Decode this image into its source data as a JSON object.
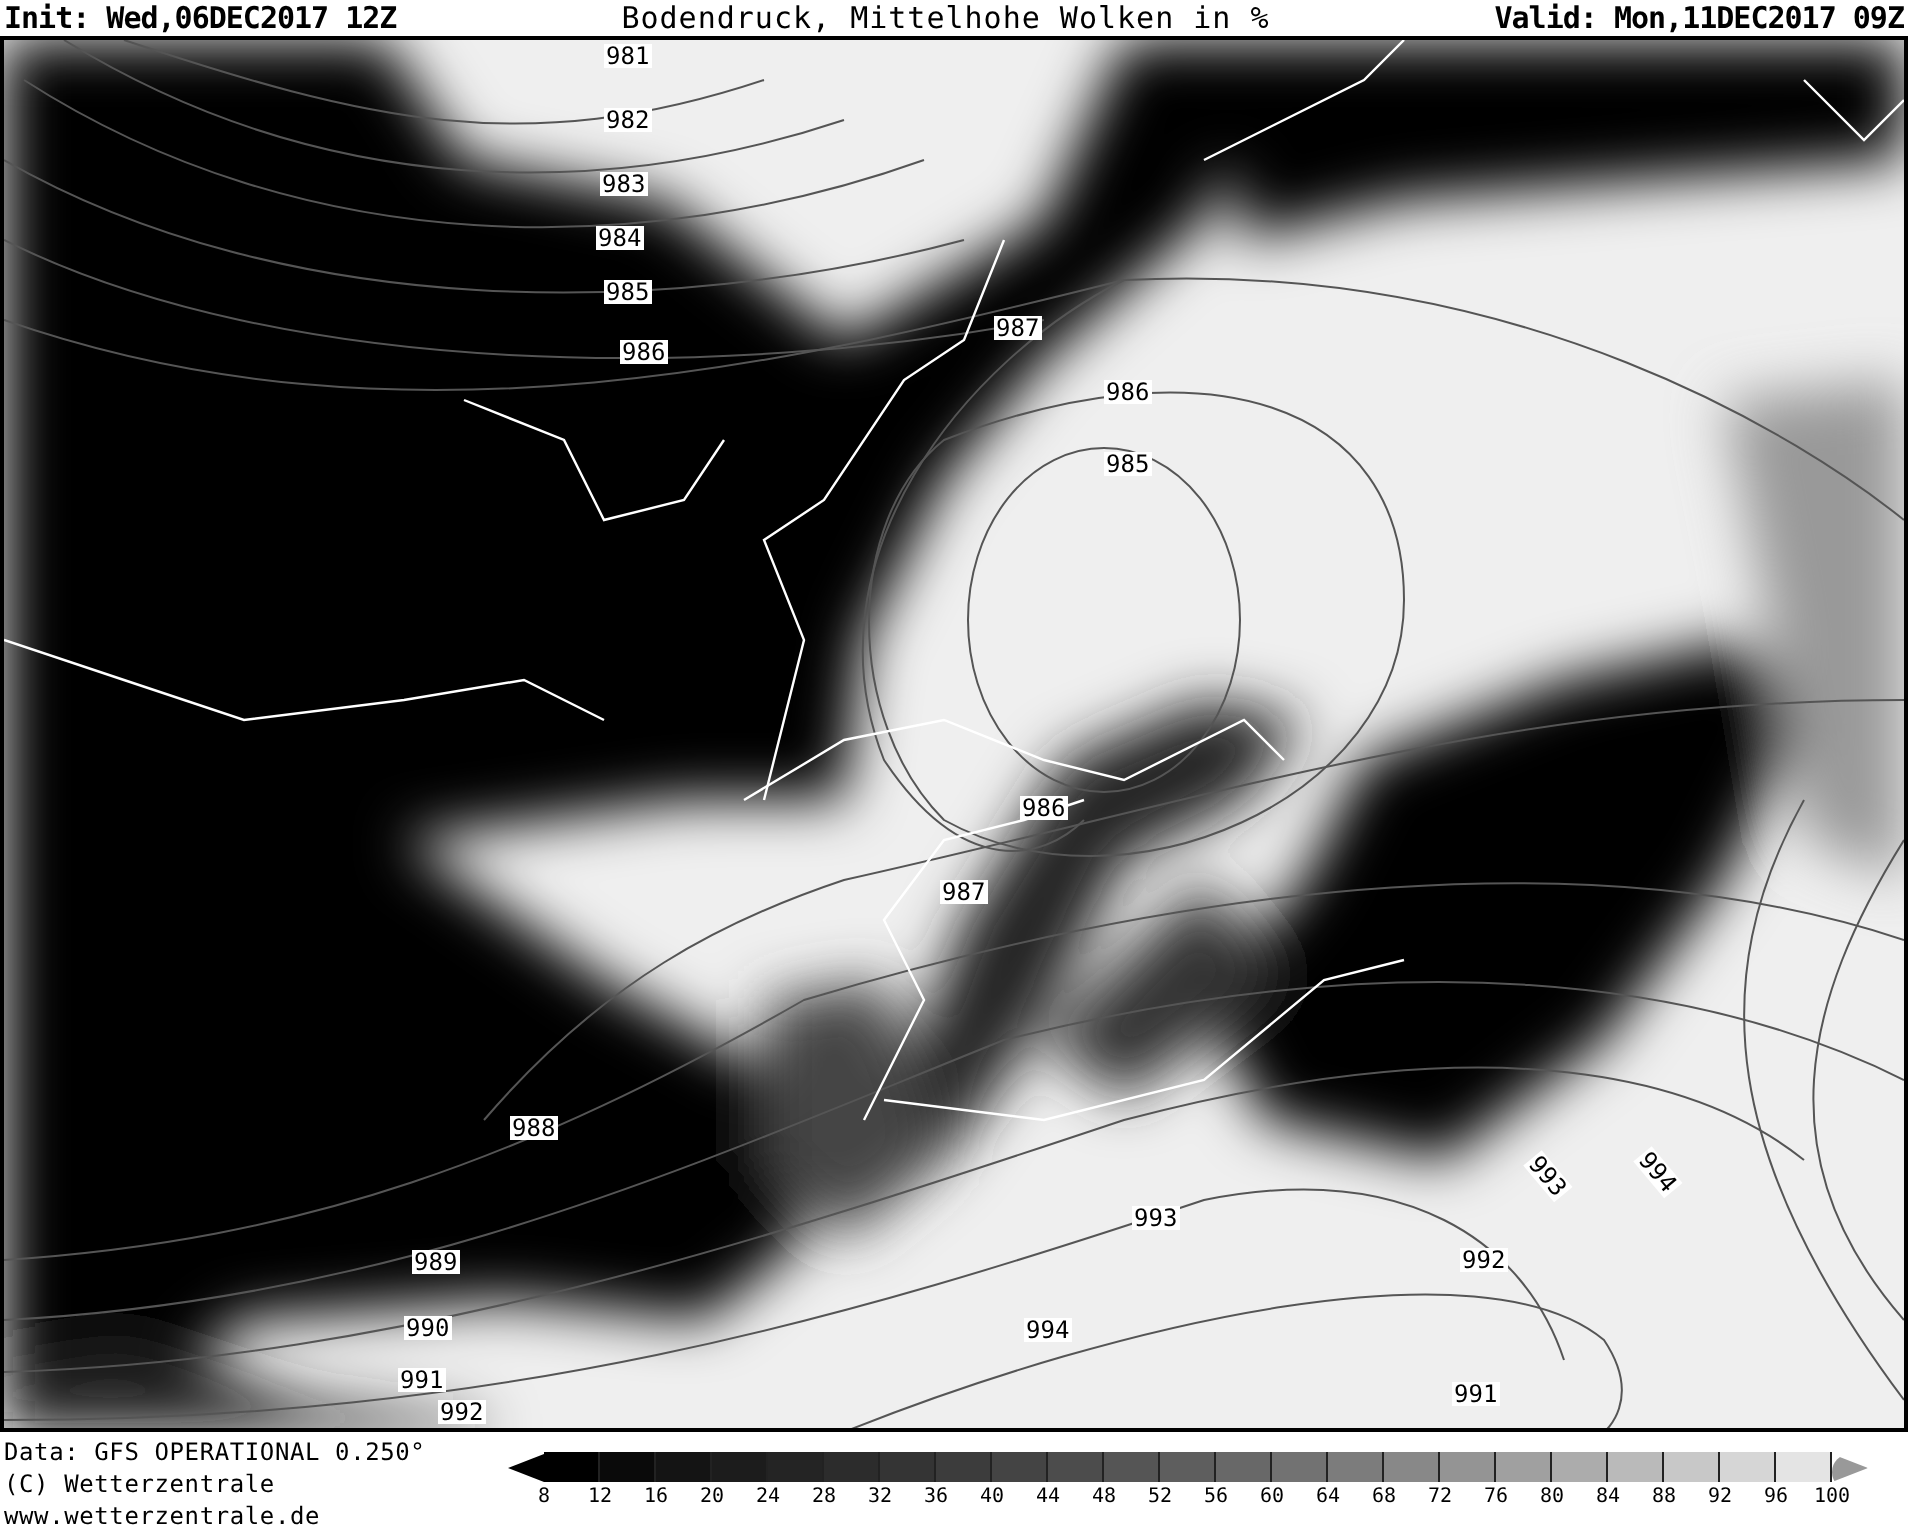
{
  "header": {
    "init": "Init: Wed,06DEC2017 12Z",
    "title": "Bodendruck, Mittelhohe Wolken in %",
    "valid": "Valid: Mon,11DEC2017 09Z"
  },
  "isobar_labels": [
    "981",
    "982",
    "983",
    "984",
    "985",
    "986",
    "987",
    "986",
    "985",
    "986",
    "987",
    "988",
    "989",
    "990",
    "991",
    "992",
    "993",
    "994",
    "992",
    "993",
    "994",
    "991"
  ],
  "footer": {
    "lines": [
      "Data: GFS OPERATIONAL 0.250°",
      "(C) Wetterzentrale",
      "www.wetterzentrale.de"
    ]
  },
  "legend": {
    "ticks": [
      "8",
      "12",
      "16",
      "20",
      "24",
      "28",
      "32",
      "36",
      "40",
      "44",
      "48",
      "52",
      "56",
      "60",
      "64",
      "68",
      "72",
      "76",
      "80",
      "84",
      "88",
      "92",
      "96",
      "100"
    ],
    "bins": [
      {
        "color": "#000000"
      },
      {
        "color": "#0a0a0a"
      },
      {
        "color": "#141414"
      },
      {
        "color": "#1c1c1c"
      },
      {
        "color": "#242424"
      },
      {
        "color": "#2c2c2c"
      },
      {
        "color": "#343434"
      },
      {
        "color": "#3c3c3c"
      },
      {
        "color": "#444444"
      },
      {
        "color": "#4c4c4c"
      },
      {
        "color": "#555555"
      },
      {
        "color": "#5e5e5e"
      },
      {
        "color": "#686868"
      },
      {
        "color": "#727272"
      },
      {
        "color": "#7c7c7c"
      },
      {
        "color": "#888888"
      },
      {
        "color": "#949494"
      },
      {
        "color": "#a0a0a0"
      },
      {
        "color": "#acacac"
      },
      {
        "color": "#bababa"
      },
      {
        "color": "#c8c8c8"
      },
      {
        "color": "#d6d6d6"
      },
      {
        "color": "#e4e4e4"
      }
    ]
  }
}
